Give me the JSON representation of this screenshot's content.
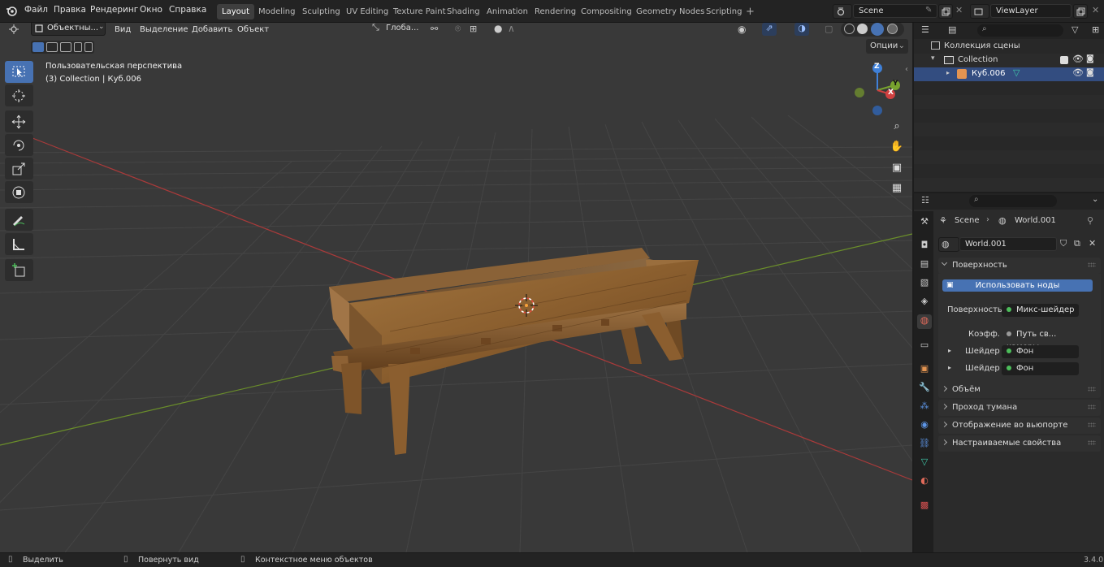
{
  "topbar": {
    "menus": [
      "Файл",
      "Правка",
      "Рендеринг",
      "Окно",
      "Справка"
    ],
    "workspaces": [
      "Layout",
      "Modeling",
      "Sculpting",
      "UV Editing",
      "Texture Paint",
      "Shading",
      "Animation",
      "Rendering",
      "Compositing",
      "Geometry Nodes",
      "Scripting"
    ],
    "active_workspace": "Layout",
    "add_workspace": "+",
    "scene_name": "Scene",
    "view_layer": "ViewLayer"
  },
  "viewport": {
    "mode": "Объектны...",
    "menus": [
      "Вид",
      "Выделение",
      "Добавить",
      "Объект"
    ],
    "transform_orientation": "Глоба...",
    "options_label": "Опции",
    "overlay_title": "Пользовательская перспектива",
    "overlay_subtitle": "(3) Collection | Куб.006",
    "gizmo_labels": {
      "z": "Z",
      "y": "Y",
      "x": "X"
    },
    "colors": {
      "background": "#393939",
      "x_axis": "#d04040",
      "y_axis": "#78a32e",
      "z_axis": "#3f80d8",
      "accent": "#4772b3"
    }
  },
  "tools": [
    "select-box",
    "cursor",
    "move",
    "rotate",
    "scale",
    "transform",
    "annotate",
    "measure",
    "add-cube"
  ],
  "outliner": {
    "scene_collection": "Коллекция сцены",
    "collection": "Collection",
    "object": "Куб.006"
  },
  "properties": {
    "breadcrumb_scene": "Scene",
    "breadcrumb_world": "World.001",
    "world_name": "World.001",
    "surface_panel": "Поверхность",
    "use_nodes_button": "Использовать ноды",
    "surface_label": "Поверхность",
    "surface_value": "Микс-шейдер",
    "factor_label": "Коэфф.",
    "factor_value": "Путь св... камеры",
    "shader1_label": "Шейдер",
    "shader1_value": "Фон",
    "shader2_label": "Шейдер",
    "shader2_value": "Фон",
    "panels": [
      "Объём",
      "Проход тумана",
      "Отображение во вьюпорте",
      "Настраиваемые свойства"
    ]
  },
  "statusbar": {
    "select": "Выделить",
    "rotate_view": "Повернуть вид",
    "context_menu": "Контекстное меню объектов",
    "version": "3.4.0"
  }
}
